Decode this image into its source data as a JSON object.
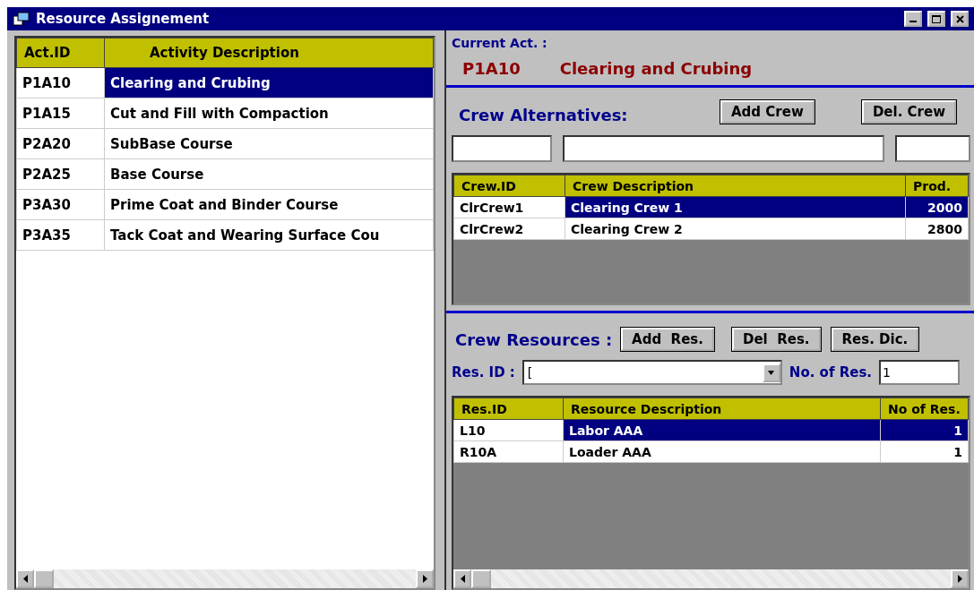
{
  "window": {
    "title": "Resource Assignement"
  },
  "activities": {
    "columns": [
      "Act.ID",
      "Activity Description"
    ],
    "rows": [
      {
        "id": "P1A10",
        "description": "Clearing and Crubing",
        "selected": true
      },
      {
        "id": "P1A15",
        "description": "Cut and Fill with Compaction",
        "selected": false
      },
      {
        "id": "P2A20",
        "description": "SubBase Course",
        "selected": false
      },
      {
        "id": "P2A25",
        "description": "Base Course",
        "selected": false
      },
      {
        "id": "P3A30",
        "description": "Prime Coat and Binder Course",
        "selected": false
      },
      {
        "id": "P3A35",
        "description": "Tack Coat and Wearing Surface Cou",
        "selected": false
      }
    ]
  },
  "current_activity": {
    "label": "Current Act. :",
    "id": "P1A10",
    "description": "Clearing and Crubing"
  },
  "crew_alternatives": {
    "label": "Crew Alternatives:",
    "buttons": [
      "Add Crew",
      "Del. Crew"
    ],
    "columns": [
      "Crew.ID",
      "Crew Description",
      "Prod."
    ],
    "rows": [
      {
        "id": "ClrCrew1",
        "description": "Clearing Crew 1",
        "value": "2000",
        "selected": true
      },
      {
        "id": "ClrCrew2",
        "description": "Clearing Crew 2",
        "value": "2800",
        "selected": false
      }
    ]
  },
  "crew_resources": {
    "label": "Crew Resources :",
    "buttons": [
      "Add  Res.",
      "Del  Res.",
      "Res. Dic."
    ],
    "res_id_label": "Res. ID :",
    "res_id_value": "[",
    "count_label": "No. of Res.",
    "count_value": "1",
    "columns": [
      "Res.ID",
      "Resource Description",
      "No of Res."
    ],
    "rows": [
      {
        "id": "L10",
        "description": "Labor  AAA",
        "value": "1",
        "selected": true
      },
      {
        "id": "R10A",
        "description": "Loader  AAA",
        "value": "1",
        "selected": false
      }
    ]
  }
}
